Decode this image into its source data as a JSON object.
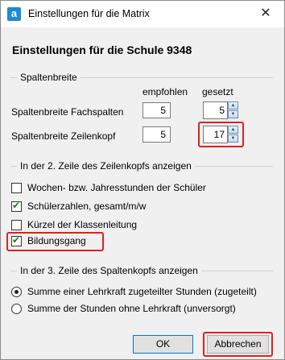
{
  "window": {
    "title": "Einstellungen für die Matrix",
    "app_icon": "a",
    "close_glyph": "✕"
  },
  "heading": "Einstellungen für die Schule 9348",
  "spaltenbreite": {
    "group_title": "Spaltenbreite",
    "col_recommended": "empfohlen",
    "col_set": "gesetzt",
    "rows": [
      {
        "label": "Spaltenbreite Fachspalten",
        "recommended": "5",
        "set": "5"
      },
      {
        "label": "Spaltenbreite Zeilenkopf",
        "recommended": "5",
        "set": "17"
      }
    ]
  },
  "zeilenkopf": {
    "group_title": "In der 2. Zeile des Zeilenkopfs anzeigen",
    "options": [
      {
        "label": "Wochen- bzw. Jahresstunden der Schüler",
        "checked": false
      },
      {
        "label": "Schülerzahlen, gesamt/m/w",
        "checked": true
      },
      {
        "label": "Kürzel der Klassenleitung",
        "checked": false
      },
      {
        "label": "Bildungsgang",
        "checked": true
      }
    ]
  },
  "spaltenkopf": {
    "group_title": "In der 3. Zeile des Spaltenkopfs anzeigen",
    "options": [
      {
        "label": "Summe einer Lehrkraft zugeteilter Stunden (zugeteilt)",
        "selected": true
      },
      {
        "label": "Summe der Stunden ohne Lehrkraft (unversorgt)",
        "selected": false
      }
    ]
  },
  "buttons": {
    "ok": "OK",
    "cancel": "Abbrechen"
  },
  "colors": {
    "highlight": "#e02020",
    "accent": "#0078d7",
    "check": "#1e7d1e"
  }
}
